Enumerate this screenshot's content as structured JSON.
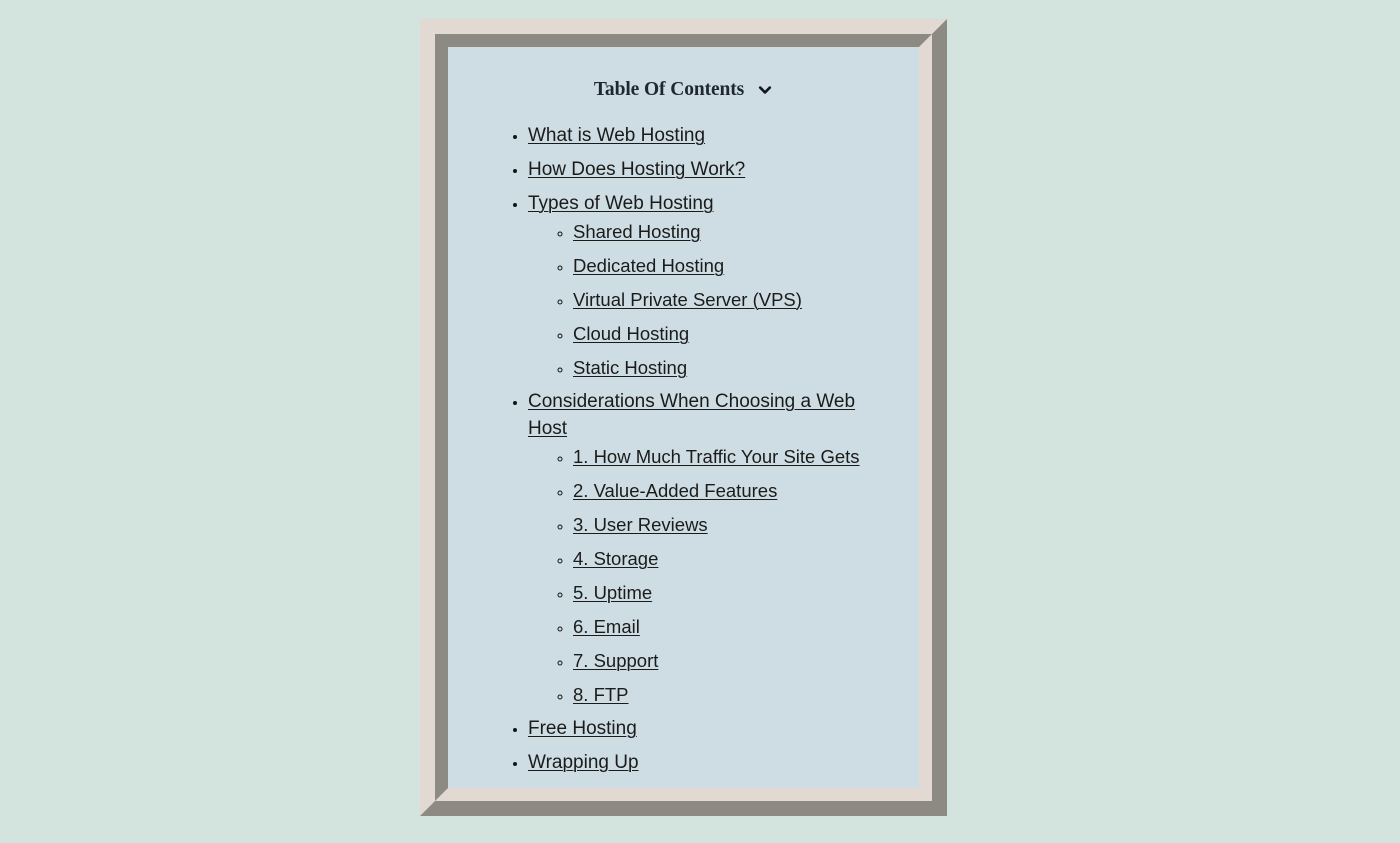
{
  "page": {
    "background_color": "#d3e3dd"
  },
  "frame": {
    "bevel_light_color": "#e2dad2",
    "bevel_dark_color": "#8d8a84",
    "panel_color": "#cedde3"
  },
  "toc": {
    "title": "Table Of Contents",
    "toggle_icon": "chevron-down-icon",
    "items": [
      {
        "label": "What is Web Hosting",
        "children": []
      },
      {
        "label": "How Does Hosting Work?",
        "children": []
      },
      {
        "label": "Types of Web Hosting",
        "children": [
          {
            "label": "Shared Hosting"
          },
          {
            "label": "Dedicated Hosting"
          },
          {
            "label": "Virtual Private Server (VPS)"
          },
          {
            "label": "Cloud Hosting"
          },
          {
            "label": "Static Hosting"
          }
        ]
      },
      {
        "label": "Considerations When Choosing a Web Host",
        "children": [
          {
            "label": "1. How Much Traffic Your Site Gets"
          },
          {
            "label": "2. Value-Added Features"
          },
          {
            "label": "3. User Reviews"
          },
          {
            "label": "4. Storage"
          },
          {
            "label": "5. Uptime"
          },
          {
            "label": "6. Email"
          },
          {
            "label": "7. Support"
          },
          {
            "label": "8. FTP"
          }
        ]
      },
      {
        "label": "Free Hosting",
        "children": []
      },
      {
        "label": "Wrapping Up",
        "children": []
      }
    ]
  }
}
